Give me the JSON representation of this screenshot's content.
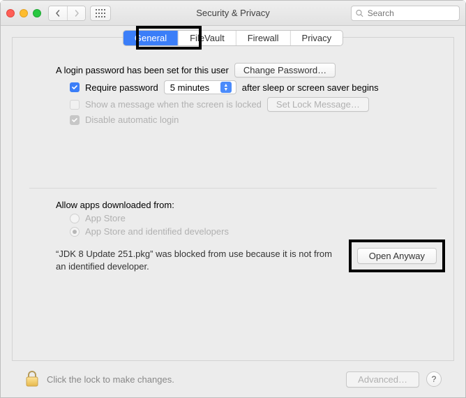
{
  "window": {
    "title": "Security & Privacy"
  },
  "search": {
    "placeholder": "Search",
    "value": ""
  },
  "tabs": {
    "items": [
      {
        "label": "General",
        "active": true
      },
      {
        "label": "FileVault",
        "active": false
      },
      {
        "label": "Firewall",
        "active": false
      },
      {
        "label": "Privacy",
        "active": false
      }
    ]
  },
  "general": {
    "login_password_set_text": "A login password has been set for this user",
    "change_password_button": "Change Password…",
    "require_password_label": "Require password",
    "require_password_checked": true,
    "require_password_delay": "5 minutes",
    "require_password_after_text": "after sleep or screen saver begins",
    "show_message_label": "Show a message when the screen is locked",
    "show_message_checked": false,
    "set_lock_message_button": "Set Lock Message…",
    "disable_auto_login_label": "Disable automatic login",
    "disable_auto_login_checked": true,
    "allow_apps_header": "Allow apps downloaded from:",
    "allow_apps_options": {
      "app_store": "App Store",
      "app_store_and_identified": "App Store and identified developers"
    },
    "allow_apps_selected": "app_store_and_identified",
    "blocked_message": "“JDK 8 Update 251.pkg” was blocked from use because it is not from an identified developer.",
    "open_anyway_button": "Open Anyway"
  },
  "footer": {
    "lock_text": "Click the lock to make changes.",
    "advanced_button": "Advanced…"
  },
  "accent_color": "#3b7ef8"
}
